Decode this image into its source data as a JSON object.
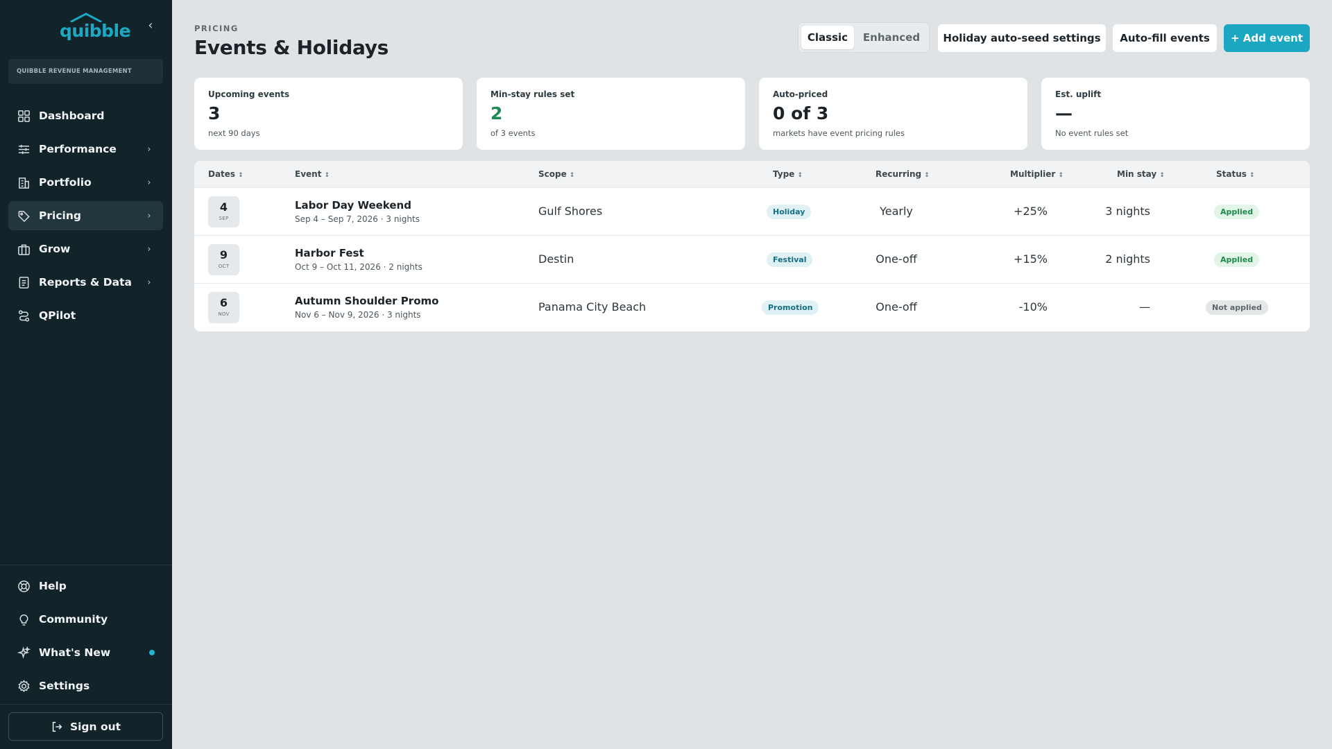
{
  "sidebar": {
    "logo_text": "quibble",
    "org_name": "QUIBBLE REVENUE MANAGEMENT",
    "collapse_icon": "chevron-left-icon",
    "nav": [
      {
        "label": "Dashboard",
        "icon": "grid-icon",
        "has_chevron": false,
        "active": false
      },
      {
        "label": "Performance",
        "icon": "sliders-icon",
        "has_chevron": true,
        "active": false
      },
      {
        "label": "Portfolio",
        "icon": "building-icon",
        "has_chevron": true,
        "active": false
      },
      {
        "label": "Pricing",
        "icon": "tag-icon",
        "has_chevron": true,
        "active": true
      },
      {
        "label": "Grow",
        "icon": "briefcase-icon",
        "has_chevron": true,
        "active": false
      },
      {
        "label": "Reports & Data",
        "icon": "report-icon",
        "has_chevron": true,
        "active": false
      },
      {
        "label": "QPilot",
        "icon": "route-icon",
        "has_chevron": false,
        "active": false
      }
    ],
    "bottom_nav": [
      {
        "label": "Help",
        "icon": "lifebuoy-icon"
      },
      {
        "label": "Community",
        "icon": "lightbulb-icon"
      },
      {
        "label": "What's New",
        "icon": "sparkles-icon",
        "has_dot": true
      },
      {
        "label": "Settings",
        "icon": "gear-icon"
      }
    ],
    "signout_label": "Sign out"
  },
  "header": {
    "eyebrow": "PRICING",
    "title": "Events & Holidays",
    "view_toggle": {
      "options": [
        "Classic",
        "Enhanced"
      ],
      "selected": "Classic"
    },
    "buttons": {
      "seed": "Holiday auto-seed settings",
      "autofill": "Auto-fill events",
      "add": "+ Add event"
    }
  },
  "stats": [
    {
      "label": "Upcoming events",
      "value": "3",
      "sub": "next 90 days"
    },
    {
      "label": "Min-stay rules set",
      "value": "2",
      "sub": "of 3 events"
    },
    {
      "label": "Auto-priced",
      "value": "0 of 3",
      "sub": "markets have event pricing rules"
    },
    {
      "label": "Est. uplift",
      "value": "—",
      "sub": "No event rules set"
    }
  ],
  "table": {
    "columns": [
      "Dates",
      "Event",
      "Scope",
      "Type",
      "Recurring",
      "Multiplier",
      "Min stay",
      "Status"
    ],
    "rows": [
      {
        "day": "4",
        "month": "SEP",
        "name": "Labor Day Weekend",
        "dates": "Sep 4 – Sep 7, 2026 · 3 nights",
        "scope": "Gulf Shores",
        "type": "Holiday",
        "recurring": "Yearly",
        "multiplier": "+25%",
        "min_stay": "3 nights",
        "status": "Applied"
      },
      {
        "day": "9",
        "month": "OCT",
        "name": "Harbor Fest",
        "dates": "Oct 9 – Oct 11, 2026 · 2 nights",
        "scope": "Destin",
        "type": "Festival",
        "recurring": "One-off",
        "multiplier": "+15%",
        "min_stay": "2 nights",
        "status": "Applied"
      },
      {
        "day": "6",
        "month": "NOV",
        "name": "Autumn Shoulder Promo",
        "dates": "Nov 6 – Nov 9, 2026 · 3 nights",
        "scope": "Panama City Beach",
        "type": "Promotion",
        "recurring": "One-off",
        "multiplier": "-10%",
        "min_stay": "—",
        "status": "Not applied"
      }
    ]
  },
  "colors": {
    "sidebar_bg": "#13232a",
    "accent": "#1ba6c1",
    "page_bg": "#dfe3e6",
    "applied": "#1d8a4e",
    "positive_value": "#1c8a56"
  }
}
